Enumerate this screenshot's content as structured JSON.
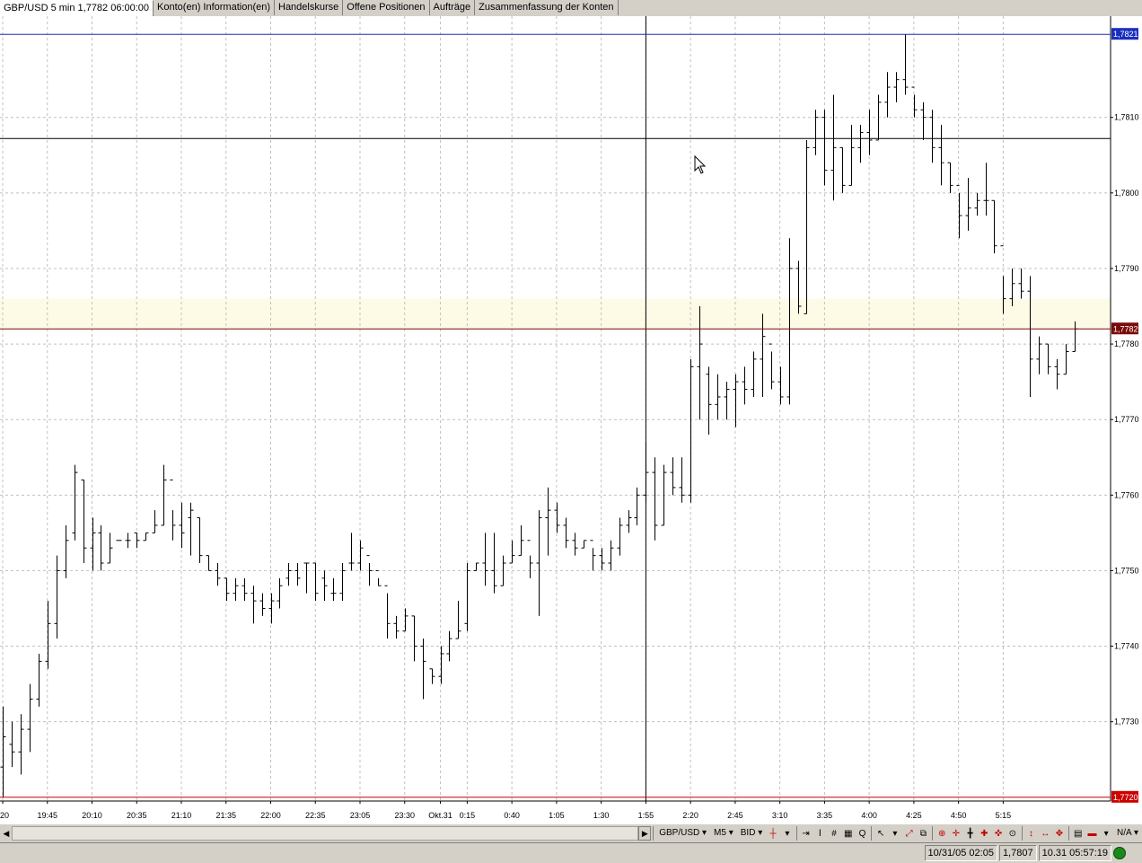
{
  "tabs": [
    {
      "label": "GBP/USD 5 min 1,7782 06:00:00",
      "active": true
    },
    {
      "label": "Konto(en) Information(en)",
      "active": false
    },
    {
      "label": "Handelskurse",
      "active": false
    },
    {
      "label": "Offene Positionen",
      "active": false
    },
    {
      "label": "Aufträge",
      "active": false
    },
    {
      "label": "Zusammenfassung der Konten",
      "active": false
    }
  ],
  "chart_data": {
    "type": "ohlc",
    "symbol": "GBP/USD",
    "timeframe": "5 min",
    "ylim": [
      1.77195,
      1.78234
    ],
    "yticks": [
      1.773,
      1.774,
      1.775,
      1.776,
      1.777,
      1.778,
      1.779,
      1.78,
      1.781
    ],
    "ytick_labels": [
      "1,7730",
      "1,7740",
      "1,7750",
      "1,7760",
      "1,7770",
      "1,7780",
      "1,7790",
      "1,7800",
      "1,7810"
    ],
    "xtick_labels": [
      "20",
      "19:45",
      "20:10",
      "20:35",
      "21:10",
      "21:35",
      "22:00",
      "22:35",
      "23:05",
      "23:30",
      "Okt.31",
      "0:15",
      "0:40",
      "1:05",
      "1:30",
      "1:55",
      "2:20",
      "2:45",
      "3:10",
      "3:35",
      "4:00",
      "4:25",
      "4:50",
      "5:15"
    ],
    "xtick_label_index": [
      0,
      5,
      10,
      15,
      20,
      25,
      30,
      35,
      40,
      45,
      49,
      52,
      57,
      62,
      67,
      72,
      77,
      82,
      87,
      92,
      97,
      102,
      107,
      112
    ],
    "bar_start_index": -2,
    "bar_spacing_ticks": 5,
    "bars": [
      [
        1.7735,
        1.7736,
        1.772,
        1.7728
      ],
      [
        1.773,
        1.7734,
        1.7722,
        1.7724
      ],
      [
        1.7724,
        1.7732,
        1.772,
        1.7728
      ],
      [
        1.7727,
        1.773,
        1.7724,
        1.7726
      ],
      [
        1.7726,
        1.7731,
        1.7723,
        1.7729
      ],
      [
        1.7729,
        1.7735,
        1.7726,
        1.7733
      ],
      [
        1.7733,
        1.7739,
        1.7732,
        1.7738
      ],
      [
        1.7738,
        1.7746,
        1.7737,
        1.7743
      ],
      [
        1.7743,
        1.7752,
        1.7741,
        1.775
      ],
      [
        1.775,
        1.7756,
        1.7749,
        1.7754
      ],
      [
        1.7755,
        1.7764,
        1.7754,
        1.7763
      ],
      [
        1.7762,
        1.7762,
        1.7751,
        1.7753
      ],
      [
        1.7753,
        1.7757,
        1.775,
        1.7755
      ],
      [
        1.7755,
        1.7756,
        1.775,
        1.7751
      ],
      [
        1.7751,
        1.7755,
        1.7751,
        1.7753
      ],
      [
        1.7754,
        1.7754,
        1.7754,
        1.7754
      ],
      [
        1.7754,
        1.7755,
        1.7753,
        1.7754
      ],
      [
        1.7755,
        1.7755,
        1.7753,
        1.7754
      ],
      [
        1.7754,
        1.7755,
        1.7754,
        1.7755
      ],
      [
        1.7755,
        1.7758,
        1.7755,
        1.7756
      ],
      [
        1.7756,
        1.7764,
        1.7756,
        1.7762
      ],
      [
        1.7762,
        1.7758,
        1.7754,
        1.7756
      ],
      [
        1.7756,
        1.7759,
        1.7753,
        1.7755
      ],
      [
        1.7757,
        1.7759,
        1.7752,
        1.7758
      ],
      [
        1.7757,
        1.7757,
        1.7751,
        1.7752
      ],
      [
        1.7752,
        1.7752,
        1.775,
        1.775
      ],
      [
        1.775,
        1.7751,
        1.7748,
        1.7749
      ],
      [
        1.7749,
        1.7749,
        1.7746,
        1.7747
      ],
      [
        1.7747,
        1.7749,
        1.7746,
        1.7748
      ],
      [
        1.7748,
        1.7749,
        1.7746,
        1.7747
      ],
      [
        1.7747,
        1.7748,
        1.7743,
        1.7746
      ],
      [
        1.7746,
        1.7747,
        1.7744,
        1.7745
      ],
      [
        1.7745,
        1.7747,
        1.7743,
        1.7746
      ],
      [
        1.7746,
        1.7749,
        1.7745,
        1.7748
      ],
      [
        1.7749,
        1.7751,
        1.7748,
        1.775
      ],
      [
        1.775,
        1.7751,
        1.7748,
        1.7749
      ],
      [
        1.7751,
        1.7751,
        1.7747,
        1.7751
      ],
      [
        1.7751,
        1.7751,
        1.7746,
        1.7747
      ],
      [
        1.7749,
        1.775,
        1.7746,
        1.7748
      ],
      [
        1.7747,
        1.7749,
        1.7746,
        1.7747
      ],
      [
        1.7747,
        1.7751,
        1.7746,
        1.775
      ],
      [
        1.7751,
        1.7755,
        1.775,
        1.7751
      ],
      [
        1.7751,
        1.7754,
        1.775,
        1.7753
      ],
      [
        1.7752,
        1.7751,
        1.7748,
        1.775
      ],
      [
        1.775,
        1.7749,
        1.7748,
        1.7748
      ],
      [
        1.7748,
        1.7747,
        1.7741,
        1.7743
      ],
      [
        1.7743,
        1.7744,
        1.7741,
        1.7742
      ],
      [
        1.7742,
        1.7745,
        1.7742,
        1.7744
      ],
      [
        1.7744,
        1.7744,
        1.7738,
        1.774
      ],
      [
        1.774,
        1.7741,
        1.7733,
        1.7738
      ],
      [
        1.7737,
        1.7737,
        1.7735,
        1.7736
      ],
      [
        1.7736,
        1.774,
        1.7735,
        1.7739
      ],
      [
        1.7739,
        1.7742,
        1.7738,
        1.7741
      ],
      [
        1.7741,
        1.7746,
        1.7741,
        1.7742
      ],
      [
        1.7743,
        1.7751,
        1.7742,
        1.775
      ],
      [
        1.775,
        1.7751,
        1.775,
        1.7751
      ],
      [
        1.7751,
        1.7755,
        1.7748,
        1.775
      ],
      [
        1.775,
        1.7755,
        1.7747,
        1.7748
      ],
      [
        1.7748,
        1.7752,
        1.7748,
        1.7751
      ],
      [
        1.7751,
        1.7754,
        1.7751,
        1.7752
      ],
      [
        1.7752,
        1.7756,
        1.7752,
        1.7754
      ],
      [
        1.7754,
        1.7752,
        1.7749,
        1.7751
      ],
      [
        1.7751,
        1.7758,
        1.7744,
        1.7757
      ],
      [
        1.7757,
        1.7761,
        1.7752,
        1.7758
      ],
      [
        1.7758,
        1.7759,
        1.7755,
        1.7756
      ],
      [
        1.7756,
        1.7757,
        1.7753,
        1.7754
      ],
      [
        1.7754,
        1.7755,
        1.7752,
        1.7753
      ],
      [
        1.7753,
        1.7754,
        1.7753,
        1.7754
      ],
      [
        1.7754,
        1.7753,
        1.775,
        1.7752
      ],
      [
        1.7752,
        1.7753,
        1.775,
        1.7751
      ],
      [
        1.7751,
        1.7754,
        1.775,
        1.7753
      ],
      [
        1.7753,
        1.7757,
        1.7752,
        1.7756
      ],
      [
        1.7756,
        1.7758,
        1.7755,
        1.7757
      ],
      [
        1.7757,
        1.7761,
        1.7756,
        1.776
      ],
      [
        1.776,
        1.7767,
        1.7759,
        1.7763
      ],
      [
        1.7763,
        1.7765,
        1.7754,
        1.7756
      ],
      [
        1.7756,
        1.7764,
        1.7756,
        1.7763
      ],
      [
        1.7763,
        1.7765,
        1.776,
        1.7761
      ],
      [
        1.7761,
        1.7765,
        1.7759,
        1.776
      ],
      [
        1.776,
        1.7778,
        1.7759,
        1.7777
      ],
      [
        1.7777,
        1.7785,
        1.777,
        1.778
      ],
      [
        1.7776,
        1.7777,
        1.7768,
        1.7772
      ],
      [
        1.7772,
        1.7776,
        1.777,
        1.7773
      ],
      [
        1.7773,
        1.7775,
        1.777,
        1.7774
      ],
      [
        1.7774,
        1.7776,
        1.7769,
        1.7775
      ],
      [
        1.7775,
        1.7777,
        1.7772,
        1.7774
      ],
      [
        1.7774,
        1.7779,
        1.7773,
        1.7778
      ],
      [
        1.7778,
        1.7784,
        1.7773,
        1.7781
      ],
      [
        1.778,
        1.7779,
        1.7774,
        1.7775
      ],
      [
        1.7775,
        1.7777,
        1.7772,
        1.7773
      ],
      [
        1.7773,
        1.7794,
        1.7772,
        1.779
      ],
      [
        1.779,
        1.7791,
        1.7784,
        1.7785
      ],
      [
        1.7784,
        1.7807,
        1.7784,
        1.7806
      ],
      [
        1.7806,
        1.7811,
        1.7805,
        1.781
      ],
      [
        1.781,
        1.7811,
        1.7801,
        1.7803
      ],
      [
        1.7803,
        1.7813,
        1.7799,
        1.7806
      ],
      [
        1.7806,
        1.7806,
        1.78,
        1.7801
      ],
      [
        1.7801,
        1.7809,
        1.7801,
        1.7806
      ],
      [
        1.7806,
        1.7809,
        1.7804,
        1.7808
      ],
      [
        1.7808,
        1.7811,
        1.7805,
        1.7807
      ],
      [
        1.7807,
        1.7813,
        1.7807,
        1.7812
      ],
      [
        1.7812,
        1.7816,
        1.781,
        1.7814
      ],
      [
        1.7814,
        1.7816,
        1.7812,
        1.7815
      ],
      [
        1.7815,
        1.7821,
        1.7813,
        1.7814
      ],
      [
        1.7814,
        1.7813,
        1.781,
        1.7811
      ],
      [
        1.7811,
        1.7812,
        1.7807,
        1.781
      ],
      [
        1.781,
        1.7811,
        1.7804,
        1.7806
      ],
      [
        1.7806,
        1.7809,
        1.7801,
        1.7804
      ],
      [
        1.7804,
        1.7804,
        1.78,
        1.7801
      ],
      [
        1.7801,
        1.78,
        1.7794,
        1.7797
      ],
      [
        1.7797,
        1.7802,
        1.7795,
        1.7798
      ],
      [
        1.7798,
        1.78,
        1.7797,
        1.7799
      ],
      [
        1.7799,
        1.7804,
        1.7797,
        1.7799
      ],
      [
        1.7799,
        1.7799,
        1.7792,
        1.7793
      ],
      [
        1.7793,
        1.7789,
        1.7784,
        1.7786
      ],
      [
        1.7786,
        1.779,
        1.7785,
        1.7788
      ],
      [
        1.7788,
        1.779,
        1.7786,
        1.7787
      ],
      [
        1.7787,
        1.7789,
        1.7773,
        1.7778
      ],
      [
        1.7778,
        1.7781,
        1.7776,
        1.778
      ],
      [
        1.778,
        1.778,
        1.7776,
        1.7777
      ],
      [
        1.7777,
        1.7778,
        1.7774,
        1.7776
      ],
      [
        1.7776,
        1.778,
        1.7776,
        1.7779
      ],
      [
        1.7779,
        1.7783,
        1.7779,
        1.7782
      ]
    ],
    "hlines": [
      {
        "value": 1.7821,
        "label": "1,7821",
        "color": "#1a2fbf"
      },
      {
        "value": 1.78072,
        "label": "",
        "color": "#000000"
      },
      {
        "value": 1.7782,
        "label": "1,7782",
        "color": "#7a0a0a"
      },
      {
        "value": 1.772,
        "label": "1,7720",
        "color": "#cc0000"
      }
    ],
    "highlight_band": [
      1.7782,
      1.7786
    ],
    "crosshair_bar_index": 74,
    "grid": true
  },
  "toolbar": {
    "symbol": "GBP/USD",
    "timeframe": "M5",
    "price_type": "BID",
    "na": "N/A"
  },
  "status": {
    "cursor_info": "10/31/05 02:05",
    "cursor_price": "1,7807",
    "clock": "10.31 05:57:19"
  },
  "colors": {
    "bar": "#000000",
    "grid": "#c0c0c0",
    "highlight_band": "#fdfbe6",
    "connected": "#1b8a1b"
  }
}
